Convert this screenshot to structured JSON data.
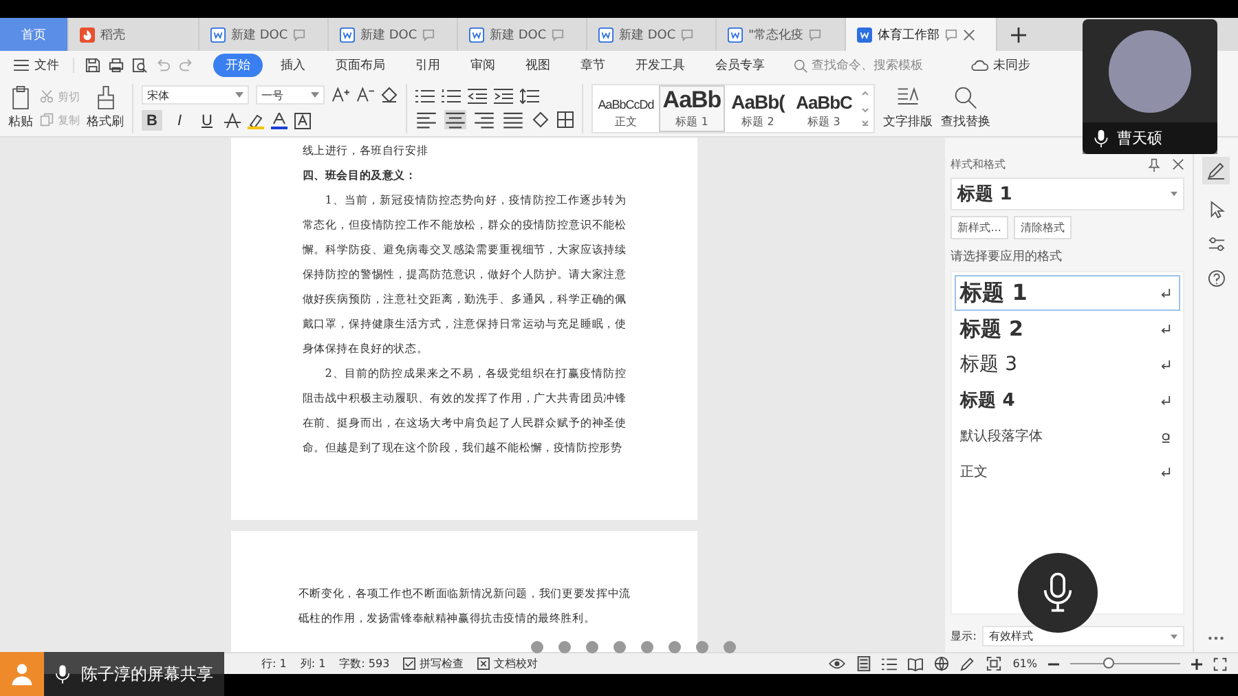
{
  "tabs": [
    {
      "kind": "home",
      "label": "首页",
      "selected": false
    },
    {
      "kind": "docer",
      "label": "稻壳",
      "selected": false
    },
    {
      "kind": "doc",
      "label": "新建 DOC",
      "selected": false
    },
    {
      "kind": "doc",
      "label": "新建 DOC",
      "selected": false
    },
    {
      "kind": "doc",
      "label": "新建 DOC",
      "selected": false
    },
    {
      "kind": "doc",
      "label": "新建 DOC",
      "selected": false
    },
    {
      "kind": "doc",
      "label": "\"常态化疫",
      "selected": false
    },
    {
      "kind": "doc",
      "label": "体育工作部",
      "selected": true
    }
  ],
  "menu": {
    "file": "文件",
    "items": [
      {
        "label": "开始",
        "selected": true
      },
      {
        "label": "插入",
        "selected": false
      },
      {
        "label": "页面布局",
        "selected": false
      },
      {
        "label": "引用",
        "selected": false
      },
      {
        "label": "审阅",
        "selected": false
      },
      {
        "label": "视图",
        "selected": false
      },
      {
        "label": "章节",
        "selected": false
      },
      {
        "label": "开发工具",
        "selected": false
      },
      {
        "label": "会员专享",
        "selected": false
      }
    ],
    "search": {
      "placeholder": "查找命令、搜索模板"
    },
    "sync_status": "未同步"
  },
  "toolbar": {
    "paste": "粘贴",
    "cut": "剪切",
    "copy": "复制",
    "format_painter": "格式刷",
    "font": "宋体",
    "font_size": "一号",
    "format_buttons": [
      {
        "kind": "bold",
        "label": "B",
        "selected": true
      },
      {
        "kind": "italic",
        "label": "I",
        "selected": false
      },
      {
        "kind": "underline",
        "label": "U",
        "selected": false
      }
    ],
    "align_buttons": [
      {
        "kind": "left",
        "selected": false
      },
      {
        "kind": "center",
        "selected": true
      },
      {
        "kind": "right",
        "selected": false
      },
      {
        "kind": "justify",
        "selected": false
      }
    ],
    "styles": [
      {
        "preview": "AaBbCcDd",
        "label": "正文",
        "kind": "normal",
        "selected": false
      },
      {
        "preview": "AaBb",
        "label": "标题 1",
        "kind": "heading1",
        "selected": true
      },
      {
        "preview": "AaBb(",
        "label": "标题 2",
        "kind": "heading2",
        "selected": false
      },
      {
        "preview": "AaBbC",
        "label": "标题 3",
        "kind": "heading3",
        "selected": false
      }
    ],
    "text_layout": "文字排版",
    "find_replace": "查找替换"
  },
  "document": {
    "pages": [
      {
        "blocks": [
          {
            "kind": "plain",
            "text": "线上进行，各班自行安排"
          },
          {
            "kind": "heading",
            "text": "四、班会目的及意义："
          },
          {
            "kind": "para",
            "text": "1、当前，新冠疫情防控态势向好，疫情防控工作逐步转为常态化，但疫情防控工作不能放松，群众的疫情防控意识不能松懈。科学防疫、避免病毒交叉感染需要重视细节，大家应该持续保持防控的警惕性，提高防范意识，做好个人防护。请大家注意做好疾病预防，注意社交距离，勤洗手、多通风，科学正确的佩戴口罩，保持健康生活方式，注意保持日常运动与充足睡眠，使身体保持在良好的状态。"
          },
          {
            "kind": "para",
            "text": "2、目前的防控成果来之不易，各级党组织在打赢疫情防控阻击战中积极主动履职、有效的发挥了作用，广大共青团员冲锋在前、挺身而出，在这场大考中肩负起了人民群众赋予的神圣使命。但越是到了现在这个阶段，我们越不能松懈，疫情防控形势"
          }
        ]
      },
      {
        "blocks": [
          {
            "kind": "plain",
            "text": "不断变化，各项工作也不断面临新情况新问题，我们更要发挥中流砥柱的作用，发扬雷锋奉献精神赢得抗击疫情的最终胜利。"
          }
        ]
      }
    ]
  },
  "style_panel": {
    "title": "样式和格式",
    "current_style": "标题 1",
    "new_style": "新样式...",
    "clear_format": "清除格式",
    "prompt": "请选择要应用的格式",
    "styles": [
      {
        "label": "标题 1",
        "kind": "heading1",
        "character_style": false,
        "selected": true
      },
      {
        "label": "标题 2",
        "kind": "heading2",
        "character_style": false,
        "selected": false
      },
      {
        "label": "标题 3",
        "kind": "heading3",
        "character_style": false,
        "selected": false
      },
      {
        "label": "标题 4",
        "kind": "heading4",
        "character_style": false,
        "selected": false
      },
      {
        "label": "默认段落字体",
        "kind": "plain",
        "character_style": true,
        "selected": false
      },
      {
        "label": "正文",
        "kind": "plain",
        "character_style": false,
        "selected": false
      }
    ],
    "show_label": "显示:",
    "show_value": "有效样式"
  },
  "status_bar": {
    "items": [
      "行: 1",
      "列: 1",
      "字数: 593"
    ],
    "spell_check": "拼写检查",
    "doc_proofread": "文档校对",
    "zoom": "61%",
    "zoom_slider": {
      "level": 0.35
    }
  },
  "video_call": {
    "name": "曹天硕"
  },
  "screen_share": {
    "label": "陈子淳的屏幕共享"
  }
}
